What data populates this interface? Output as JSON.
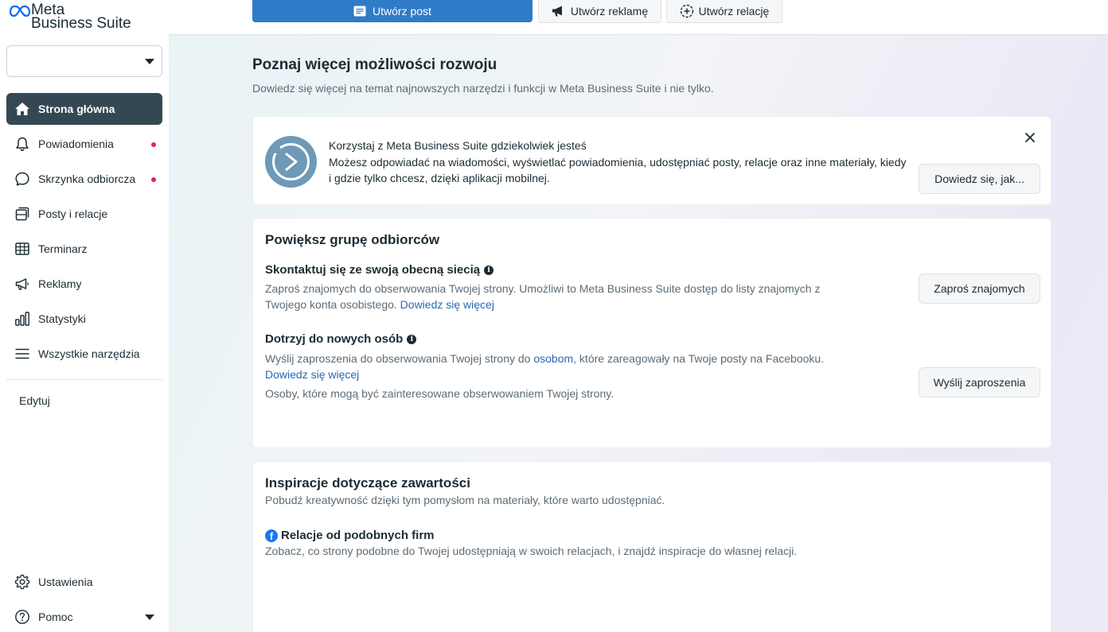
{
  "app": {
    "logo_meta": "Meta",
    "logo_business_suite": "Business Suite"
  },
  "account_select": {
    "value": ""
  },
  "sidebar": {
    "items": [
      {
        "label": "Strona główna",
        "icon": "home-icon",
        "active": true
      },
      {
        "label": "Powiadomienia",
        "icon": "bell-icon",
        "unread": true
      },
      {
        "label": "Skrzynka odbiorcza",
        "icon": "chat-bubble-icon",
        "unread": true
      },
      {
        "label": "Posty i relacje",
        "icon": "posts-icon"
      },
      {
        "label": "Terminarz",
        "icon": "calendar-table-icon"
      },
      {
        "label": "Reklamy",
        "icon": "megaphone-icon"
      },
      {
        "label": "Statystyki",
        "icon": "bar-chart-icon"
      },
      {
        "label": "Wszystkie narzędzia",
        "icon": "hamburger-menu-icon"
      }
    ],
    "edit_label": "Edytuj",
    "settings_label": "Ustawienia",
    "help_label": "Pomoc"
  },
  "toolbar": {
    "create_post": "Utwórz post",
    "create_ad": "Utwórz reklamę",
    "create_story": "Utwórz relację"
  },
  "main": {
    "title": "Poznaj więcej możliwości rozwoju",
    "subtitle": "Dowiedz się więcej na temat najnowszych narzędzi i funkcji w Meta Business Suite i nie tylko.",
    "mobile_card": {
      "title": "Korzystaj z Meta Business Suite gdziekolwiek jesteś",
      "text": "Możesz odpowiadać na wiadomości, wyświetlać powiadomienia, udostępniać posty, relacje oraz inne materiały, kiedy i gdzie tylko chcesz, dzięki aplikacji mobilnej.",
      "button": "Dowiedz się, jak..."
    },
    "audience_card": {
      "title": "Powiększ grupę odbiorców",
      "contact": {
        "title": "Skontaktuj się ze swoją obecną siecią",
        "text": "Zaproś znajomych do obserwowania Twojej strony. Umożliwi to Meta Business Suite dostęp do listy znajomych z Twojego konta osobistego.",
        "link": "Dowiedz się więcej",
        "button": "Zaproś znajomych"
      },
      "reach": {
        "title": "Dotrzyj do nowych osób",
        "text_before": "Wyślij zaproszenia do obserwowania Twojej strony do ",
        "text_link": "osobom",
        "text_after": ", które zareagowały na Twoje posty na Facebooku.",
        "link": "Dowiedz się więcej",
        "note": "Osoby, które mogą być zainteresowane obserwowaniem Twojej strony.",
        "button": "Wyślij zaproszenia"
      }
    },
    "inspiration_card": {
      "title": "Inspiracje dotyczące zawartości",
      "subtitle": "Pobudź kreatywność dzięki tym pomysłom na materiały, które warto udostępniać.",
      "stories_title": "Relacje od podobnych firm",
      "stories_text": "Zobacz, co strony podobne do Twojej udostępniają w swoich relacjach, i znajdź inspiracje do własnej relacji."
    }
  },
  "colors": {
    "primary": "#2f7bc8",
    "active_nav": "#344854",
    "notification_dot": "#e0245e",
    "link": "#2769b0",
    "facebook": "#1877f2"
  }
}
